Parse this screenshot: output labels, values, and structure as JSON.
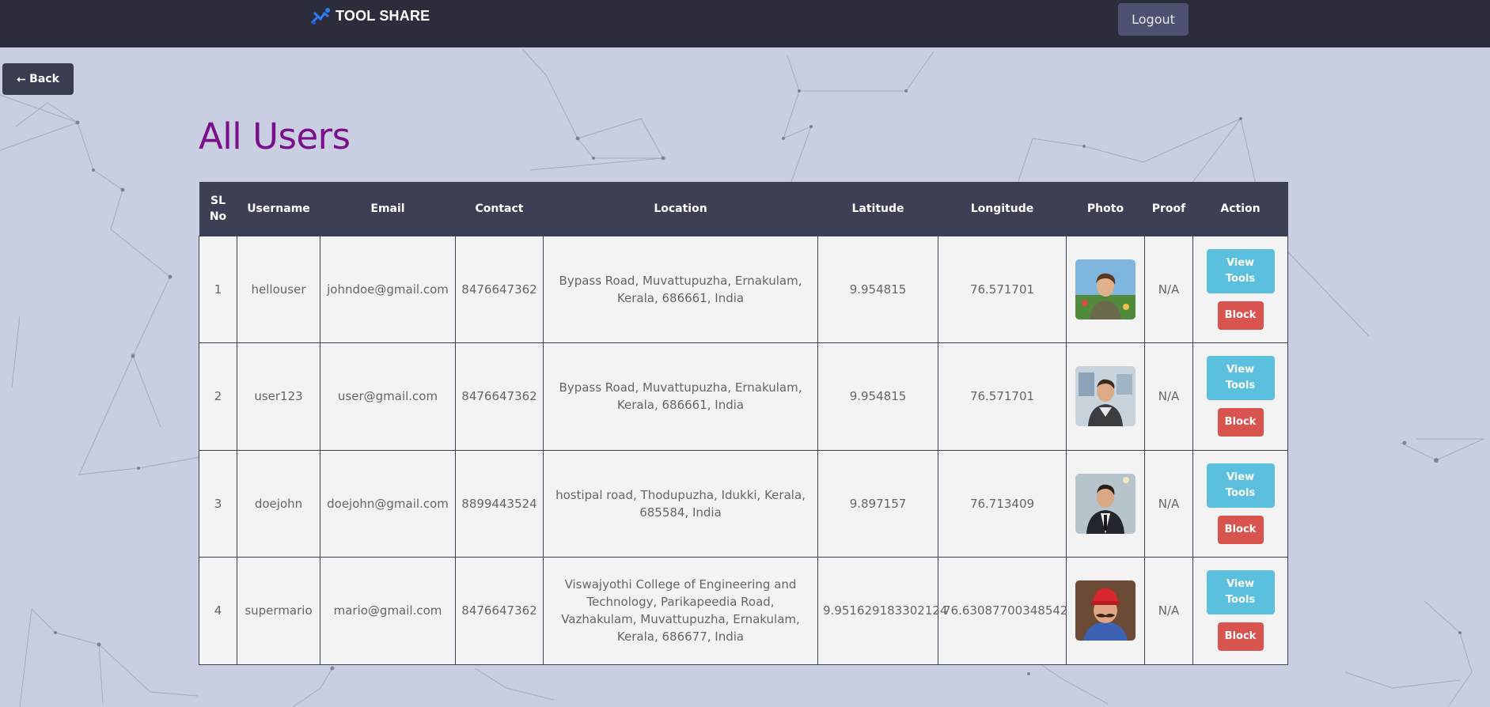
{
  "app": {
    "brand": "TOOL SHARE"
  },
  "header": {
    "logout_label": "Logout"
  },
  "nav": {
    "back_label": "⭠ Back"
  },
  "page": {
    "title": "All Users"
  },
  "colors": {
    "accent_title": "#7a0f8c",
    "view_button": "#5bc0de",
    "block_button": "#d9534f",
    "header_bg": "#2b2d3c"
  },
  "table": {
    "headers": [
      "SL No",
      "Username",
      "Email",
      "Contact",
      "Location",
      "Latitude",
      "Longitude",
      "Photo",
      "Proof",
      "Action"
    ],
    "rows": [
      {
        "sl": "1",
        "username": "hellouser",
        "email": "johndoe@gmail.com",
        "contact": "8476647362",
        "location": "Bypass Road, Muvattupuzha, Ernakulam, Kerala, 686661, India",
        "latitude": "9.954815",
        "longitude": "76.571701",
        "photo": "avatar-man-garden",
        "proof": "N/A",
        "view_label": "View Tools",
        "block_label": "Block"
      },
      {
        "sl": "2",
        "username": "user123",
        "email": "user@gmail.com",
        "contact": "8476647362",
        "location": "Bypass Road, Muvattupuzha, Ernakulam, Kerala, 686661, India",
        "latitude": "9.954815",
        "longitude": "76.571701",
        "photo": "avatar-man-office",
        "proof": "N/A",
        "view_label": "View Tools",
        "block_label": "Block"
      },
      {
        "sl": "3",
        "username": "doejohn",
        "email": "doejohn@gmail.com",
        "contact": "8899443524",
        "location": "hostipal road, Thodupuzha, Idukki, Kerala, 685584, India",
        "latitude": "9.897157",
        "longitude": "76.713409",
        "photo": "avatar-man-suit",
        "proof": "N/A",
        "view_label": "View Tools",
        "block_label": "Block"
      },
      {
        "sl": "4",
        "username": "supermario",
        "email": "mario@gmail.com",
        "contact": "8476647362",
        "location": "Viswajyothi College of Engineering and Technology, Parikapeedia Road, Vazhakulam, Muvattupuzha, Ernakulam, Kerala, 686677, India",
        "latitude": "9.951629183302124",
        "longitude": "76.63087700348542",
        "photo": "avatar-mario",
        "proof": "N/A",
        "view_label": "View Tools",
        "block_label": "Block"
      }
    ]
  }
}
